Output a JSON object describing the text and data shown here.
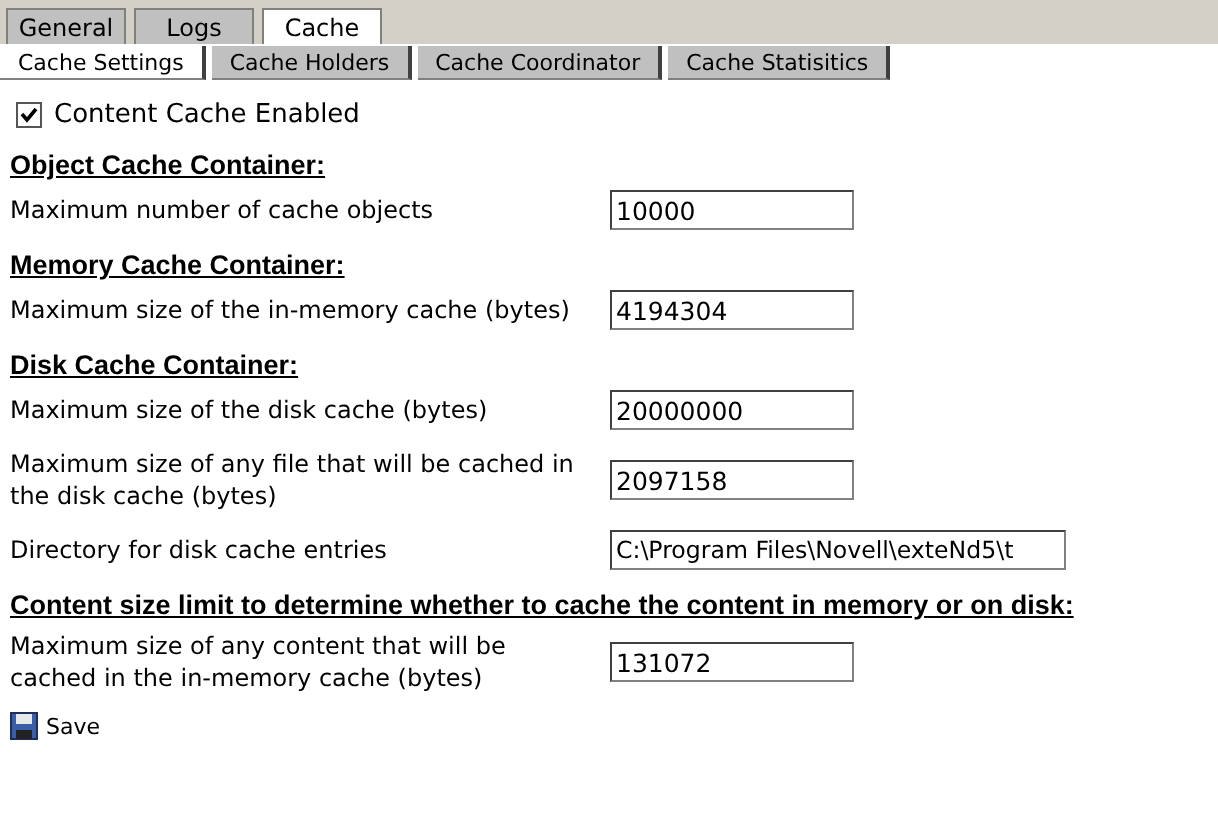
{
  "tabs": [
    {
      "label": "General",
      "selected": false
    },
    {
      "label": "Logs",
      "selected": false
    },
    {
      "label": "Cache",
      "selected": true
    }
  ],
  "subtabs": [
    {
      "label": "Cache Settings",
      "selected": true
    },
    {
      "label": "Cache Holders",
      "selected": false
    },
    {
      "label": "Cache Coordinator",
      "selected": false
    },
    {
      "label": "Cache Statisitics",
      "selected": false
    }
  ],
  "content_cache": {
    "label": "Content Cache Enabled",
    "checked": true
  },
  "sections": [
    {
      "title": "Object Cache Container:",
      "fields": [
        {
          "label": "Maximum number of cache objects",
          "value": "10000"
        }
      ]
    },
    {
      "title": "Memory Cache Container:",
      "fields": [
        {
          "label": "Maximum size of the in-memory cache (bytes)",
          "value": "4194304"
        }
      ]
    },
    {
      "title": "Disk Cache Container:",
      "fields": [
        {
          "label": "Maximum size of the disk cache (bytes)",
          "value": "20000000"
        },
        {
          "label": "Maximum size of any file that will be cached in the disk cache (bytes)",
          "value": "2097158"
        },
        {
          "label": "Directory for disk cache entries",
          "value": "C:\\Program Files\\Novell\\exteNd5\\t",
          "kind": "wide"
        }
      ]
    },
    {
      "title": "Content size limit to determine whether to cache the content in memory or on disk:",
      "fields": [
        {
          "label": "Maximum size of any content that will be cached in the in-memory cache (bytes)",
          "value": "131072"
        }
      ]
    }
  ],
  "save": "Save"
}
